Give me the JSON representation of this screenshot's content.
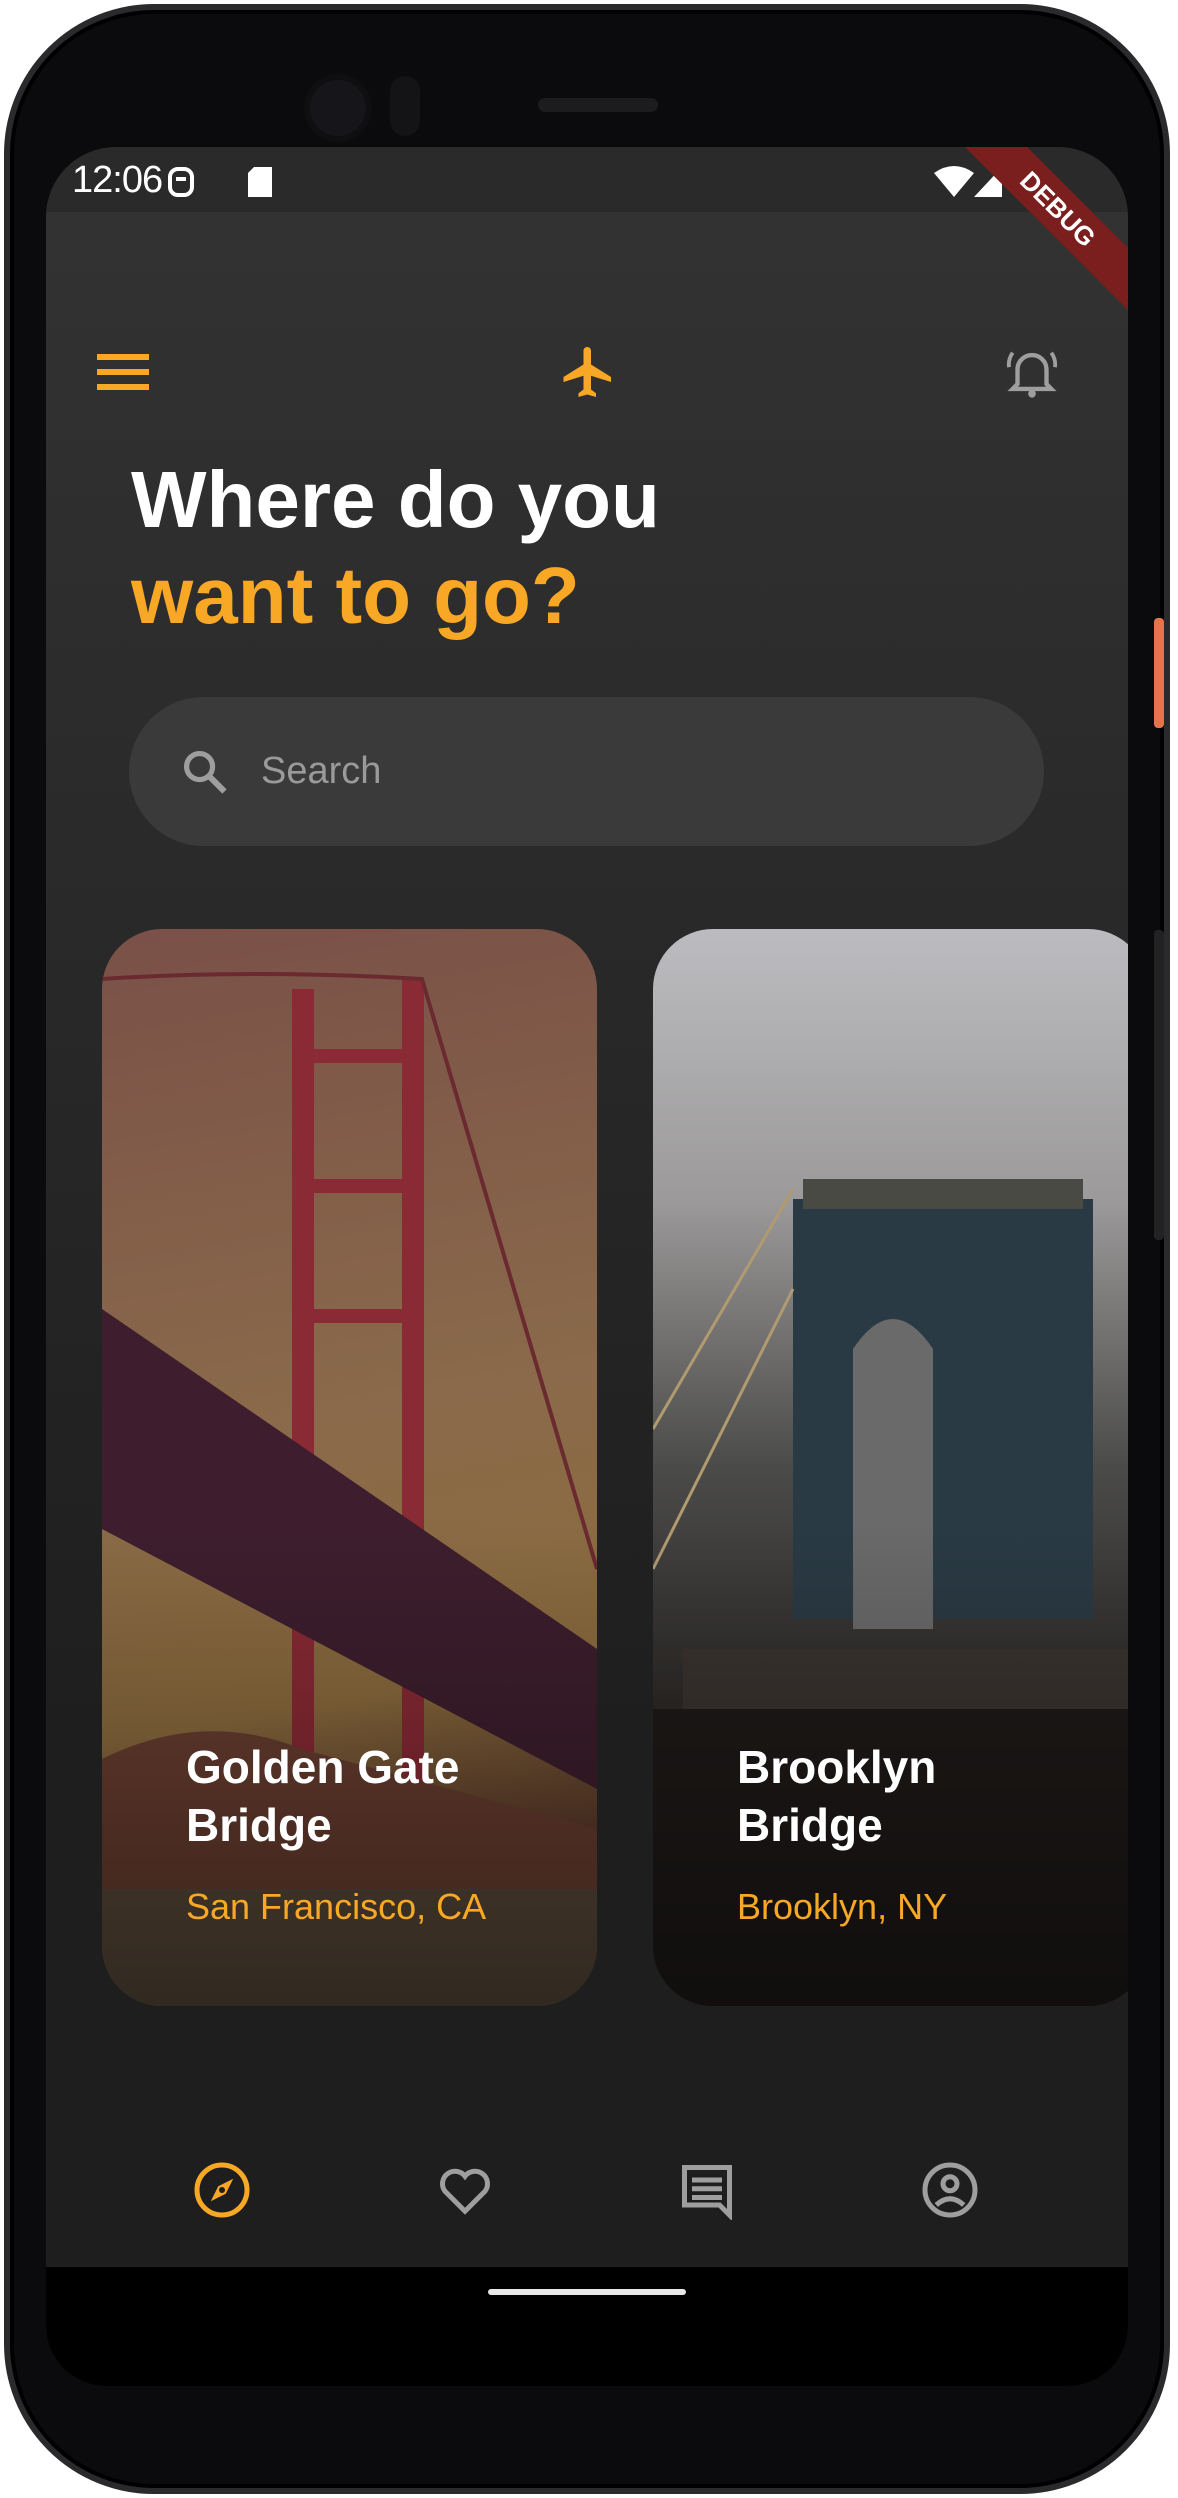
{
  "status_bar": {
    "time": "12:06",
    "debug_banner": "DEBUG"
  },
  "app_bar": {
    "menu_icon": "menu-icon",
    "logo_icon": "airplane-icon",
    "notification_icon": "alarm-bell-icon"
  },
  "heading": {
    "line1": "Where do you",
    "line2": "want to go?"
  },
  "search": {
    "placeholder": "Search"
  },
  "destinations": [
    {
      "title": "Golden Gate Bridge",
      "location": "San Francisco, CA"
    },
    {
      "title": "Brooklyn Bridge",
      "location": "Brooklyn, NY"
    }
  ],
  "bottom_nav": [
    {
      "icon": "compass-icon",
      "active": true
    },
    {
      "icon": "heart-icon",
      "active": false
    },
    {
      "icon": "chat-icon",
      "active": false
    },
    {
      "icon": "account-icon",
      "active": false
    }
  ],
  "colors": {
    "accent": "#f9a826",
    "background": "#1e1e1e",
    "inactive": "#9e9e9e",
    "search_bg": "#3a3a3a"
  }
}
